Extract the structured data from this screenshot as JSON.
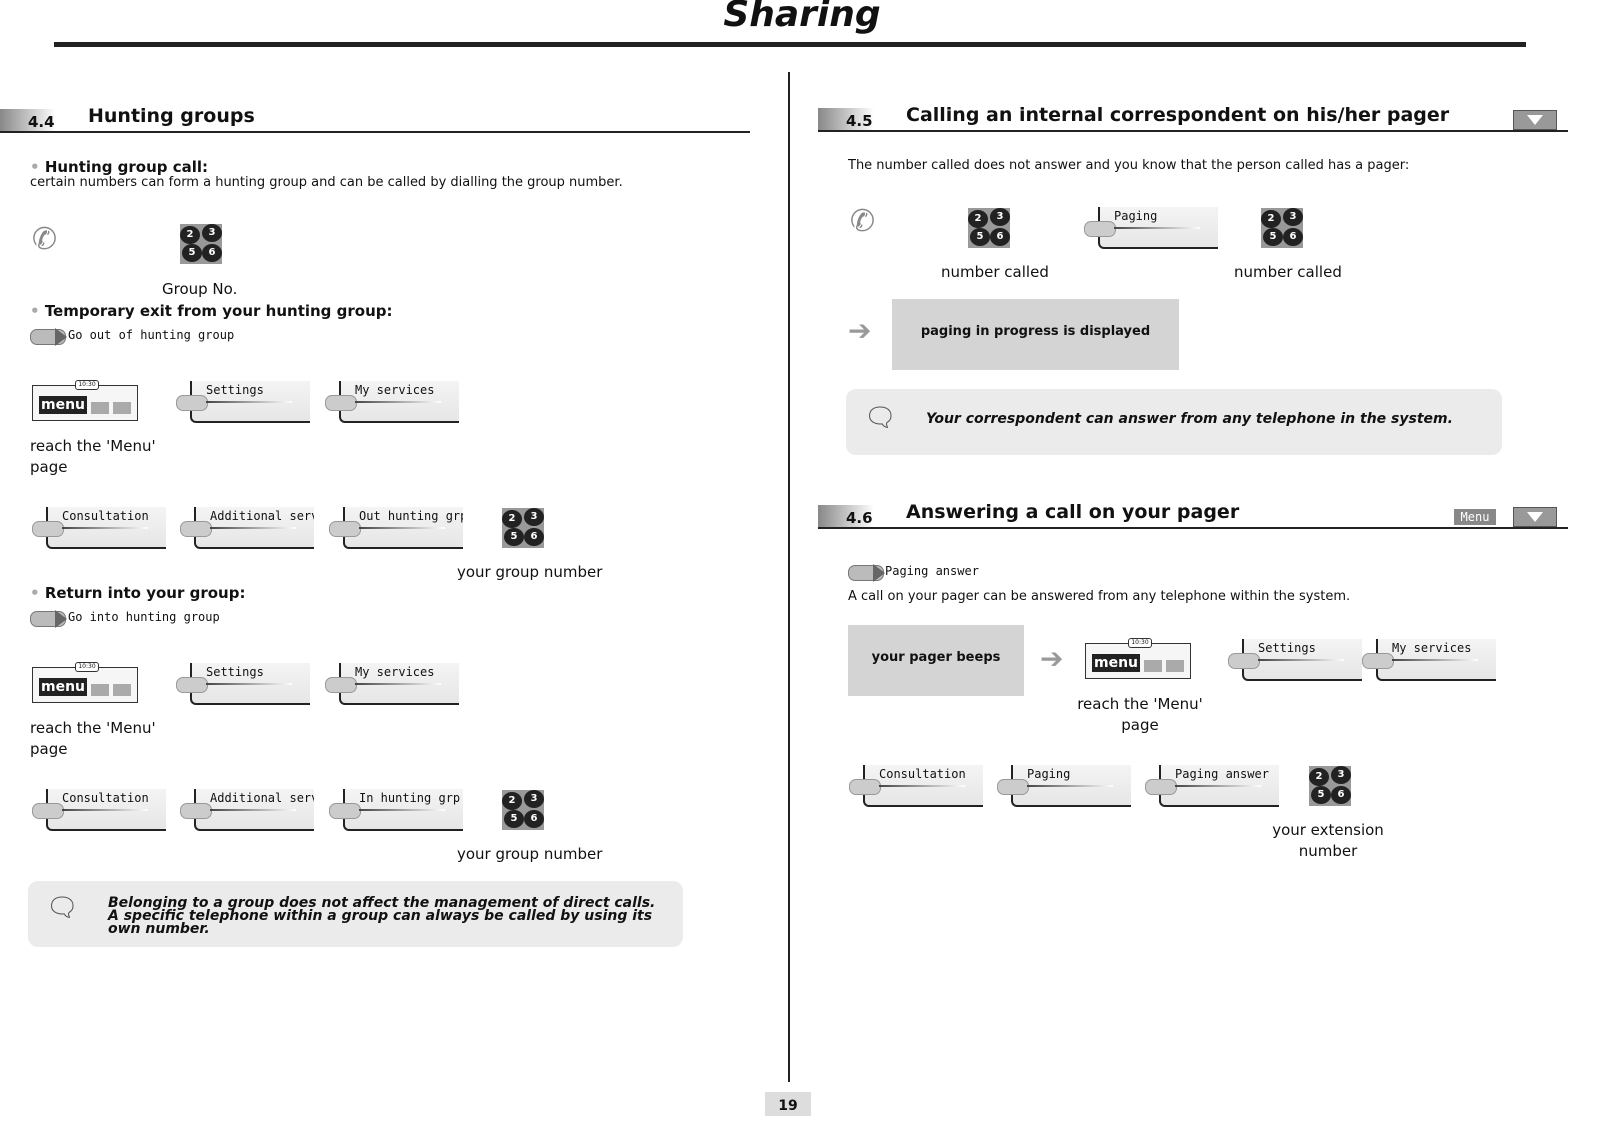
{
  "header": {
    "title": "Sharing",
    "page_number": "19"
  },
  "s44": {
    "number": "4.4",
    "title": "Hunting groups",
    "call_heading": "Hunting group call:",
    "call_text": "certain numbers can form a hunting group and can be called by dialling the group number.",
    "group_no": "Group No.",
    "exit_heading": "Temporary exit from your hunting group:",
    "exit_nav": "Go out of hunting  group",
    "reach1": "reach the 'Menu'",
    "page": "page",
    "settings": "Settings",
    "my_services": "My services",
    "consultation": "Consultation",
    "additional": "Additional services",
    "out_hunting": "Out hunting grp",
    "your_group_number": "your group number",
    "return_heading": "Return into your group:",
    "return_nav": "Go into hunting    group",
    "in_hunting": "In hunting grp",
    "note": "Belonging to a group does not affect the management of direct calls. A specific telephone within a group can always be called by using its own number."
  },
  "s45": {
    "number": "4.5",
    "title": "Calling an internal correspondent on his/her pager",
    "intro": "The number called does not answer and you know that the person called has a pager:",
    "paging": "Paging",
    "number_called": "number called",
    "progress": "paging in progress is displayed",
    "note": "Your correspondent can answer from any telephone in the system."
  },
  "s46": {
    "number": "4.6",
    "title": "Answering a call on your pager",
    "menu_label": "Menu",
    "nav": "Paging answer",
    "intro": "A call on your pager can be answered from any telephone within the system.",
    "beeps": "your pager beeps",
    "reach": "reach the 'Menu'",
    "page": "page",
    "settings": "Settings",
    "my_services": "My services",
    "consultation": "Consultation",
    "paging": "Paging",
    "paging_answer": "Paging answer",
    "ext1": "your extension",
    "ext2": "number"
  },
  "keypad": [
    "2",
    "3",
    "5",
    "6"
  ],
  "screen": {
    "clock": "10:30",
    "menu": "menu"
  }
}
